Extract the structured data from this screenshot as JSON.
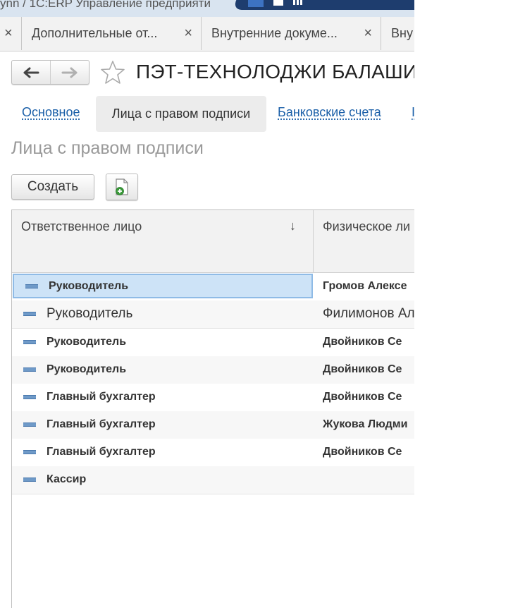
{
  "window": {
    "title": "ynn / 1С:ERP Управление предприяти"
  },
  "open_tabs": [
    {
      "label": ""
    },
    {
      "label": "Дополнительные от..."
    },
    {
      "label": "Внутренние докуме..."
    },
    {
      "label": "Вну"
    }
  ],
  "close_glyph": "×",
  "nav": {
    "back_glyph": "←",
    "forward_glyph": "→"
  },
  "page": {
    "title": "ПЭТ-ТЕХНОЛОДЖИ БАЛАШИХ"
  },
  "section_tabs": {
    "main": "Основное",
    "signers": "Лица с правом подписи",
    "bank": "Банковские счета",
    "more": "I"
  },
  "section_heading": "Лица с правом подписи",
  "toolbar": {
    "create_label": "Создать",
    "copy_icon": "document-add-icon"
  },
  "table": {
    "columns": [
      "Ответственное лицо",
      "Физическое ли"
    ],
    "sort_glyph": "↓",
    "rows": [
      {
        "role": "Руководитель",
        "person": "Громов Алексе",
        "bold": true,
        "selected": true
      },
      {
        "role": "Руководитель",
        "person": "Филимонов Ал",
        "bold": false,
        "selected": false
      },
      {
        "role": "Руководитель",
        "person": "Двойников Се",
        "bold": true,
        "selected": false
      },
      {
        "role": "Руководитель",
        "person": "Двойников Се",
        "bold": true,
        "selected": false
      },
      {
        "role": "Главный бухгалтер",
        "person": "Двойников Се",
        "bold": true,
        "selected": false
      },
      {
        "role": "Главный бухгалтер",
        "person": "Жукова Людми",
        "bold": true,
        "selected": false
      },
      {
        "role": "Главный бухгалтер",
        "person": "Двойников Се",
        "bold": true,
        "selected": false
      },
      {
        "role": "Кассир",
        "person": "",
        "bold": true,
        "selected": false
      }
    ]
  },
  "colors": {
    "link": "#1a5fa8",
    "selection": "#cde3f7",
    "titlebar_dark": "#1e3d6e"
  }
}
